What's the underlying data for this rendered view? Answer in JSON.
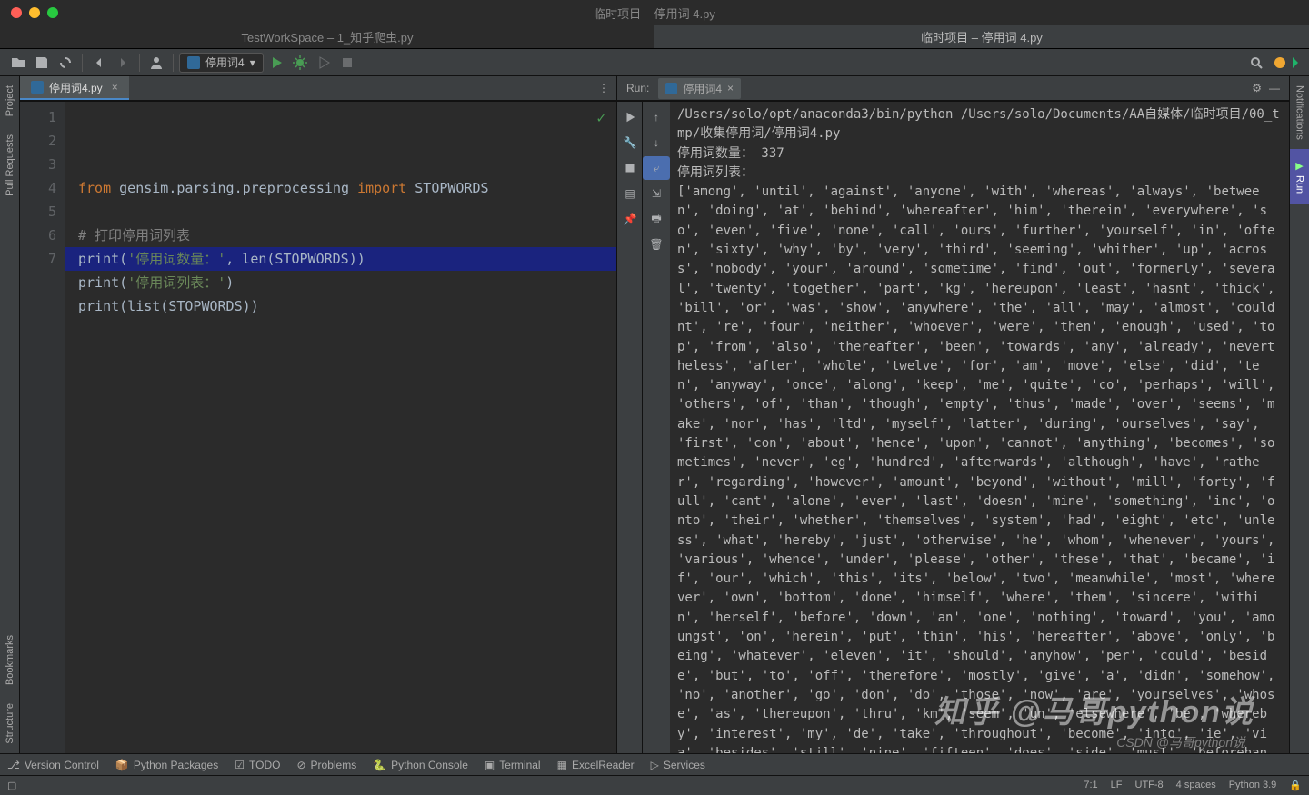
{
  "titlebar": {
    "title": "临时项目 – 停用词 4.py"
  },
  "project_tabs": [
    {
      "label": "TestWorkSpace – 1_知乎爬虫.py",
      "active": false
    },
    {
      "label": "临时项目 – 停用词 4.py",
      "active": true
    }
  ],
  "toolbar": {
    "run_config": "停用词4"
  },
  "left_tabs": [
    "Project",
    "Pull Requests",
    "Bookmarks",
    "Structure"
  ],
  "right_tabs": [
    "Notifications",
    "Run"
  ],
  "editor": {
    "tab_name": "停用词4.py",
    "lines": [
      "1",
      "2",
      "3",
      "4",
      "5",
      "6",
      "7"
    ],
    "code_html": "<span class='kw'>from</span> gensim.parsing.preprocessing <span class='kw'>import</span> STOPWORDS\n\n<span class='cmt'># 打印停用词列表</span>\nprint(<span class='str'>'停用词数量：'</span>, len(STOPWORDS))\nprint(<span class='str'>'停用词列表：'</span>)\nprint(list(STOPWORDS))\n"
  },
  "run": {
    "label": "Run:",
    "tab": "停用词4",
    "console": "/Users/solo/opt/anaconda3/bin/python /Users/solo/Documents/AA自媒体/临时项目/00_tmp/收集停用词/停用词4.py\n停用词数量： 337\n停用词列表：\n['among', 'until', 'against', 'anyone', 'with', 'whereas', 'always', 'between', 'doing', 'at', 'behind', 'whereafter', 'him', 'therein', 'everywhere', 'so', 'even', 'five', 'none', 'call', 'ours', 'further', 'yourself', 'in', 'often', 'sixty', 'why', 'by', 'very', 'third', 'seeming', 'whither', 'up', 'across', 'nobody', 'your', 'around', 'sometime', 'find', 'out', 'formerly', 'several', 'twenty', 'together', 'part', 'kg', 'hereupon', 'least', 'hasnt', 'thick', 'bill', 'or', 'was', 'show', 'anywhere', 'the', 'all', 'may', 'almost', 'couldnt', 're', 'four', 'neither', 'whoever', 'were', 'then', 'enough', 'used', 'top', 'from', 'also', 'thereafter', 'been', 'towards', 'any', 'already', 'nevertheless', 'after', 'whole', 'twelve', 'for', 'am', 'move', 'else', 'did', 'ten', 'anyway', 'once', 'along', 'keep', 'me', 'quite', 'co', 'perhaps', 'will', 'others', 'of', 'than', 'though', 'empty', 'thus', 'made', 'over', 'seems', 'make', 'nor', 'has', 'ltd', 'myself', 'latter', 'during', 'ourselves', 'say', 'first', 'con', 'about', 'hence', 'upon', 'cannot', 'anything', 'becomes', 'sometimes', 'never', 'eg', 'hundred', 'afterwards', 'although', 'have', 'rather', 'regarding', 'however', 'amount', 'beyond', 'without', 'mill', 'forty', 'full', 'cant', 'alone', 'ever', 'last', 'doesn', 'mine', 'something', 'inc', 'onto', 'their', 'whether', 'themselves', 'system', 'had', 'eight', 'etc', 'unless', 'what', 'hereby', 'just', 'otherwise', 'he', 'whom', 'whenever', 'yours', 'various', 'whence', 'under', 'please', 'other', 'these', 'that', 'became', 'if', 'our', 'which', 'this', 'its', 'below', 'two', 'meanwhile', 'most', 'wherever', 'own', 'bottom', 'done', 'himself', 'where', 'them', 'sincere', 'within', 'herself', 'before', 'down', 'an', 'one', 'nothing', 'toward', 'you', 'amoungst', 'on', 'herein', 'put', 'thin', 'his', 'hereafter', 'above', 'only', 'being', 'whatever', 'eleven', 'it', 'should', 'anyhow', 'per', 'could', 'beside', 'but', 'to', 'off', 'therefore', 'mostly', 'give', 'a', 'didn', 'somehow', 'no', 'another', 'go', 'don', 'do', 'those', 'now', 'are', 'yourselves', 'whose', 'as', 'thereupon', 'thru', 'km', 'seem', 'un', 'elsewhere', 'be', 'whereby', 'interest', 'my', 'de', 'take', 'throughout', 'become', 'into', 'ie', 'via', 'besides', 'still', 'nine', 'fifteen', 'does', 'side', 'must', 'beforehand', 'both', 'whereupon', 'due', 'either', 'three',"
  },
  "bottom_bar": [
    "Version Control",
    "Python Packages",
    "TODO",
    "Problems",
    "Python Console",
    "Terminal",
    "ExcelReader",
    "Services"
  ],
  "status": {
    "pos": "7:1",
    "lf": "LF",
    "enc": "UTF-8",
    "indent": "4 spaces",
    "py": "Python 3.9"
  },
  "watermark": "知乎 @马哥python说",
  "watermark2": "CSDN @马哥python说"
}
